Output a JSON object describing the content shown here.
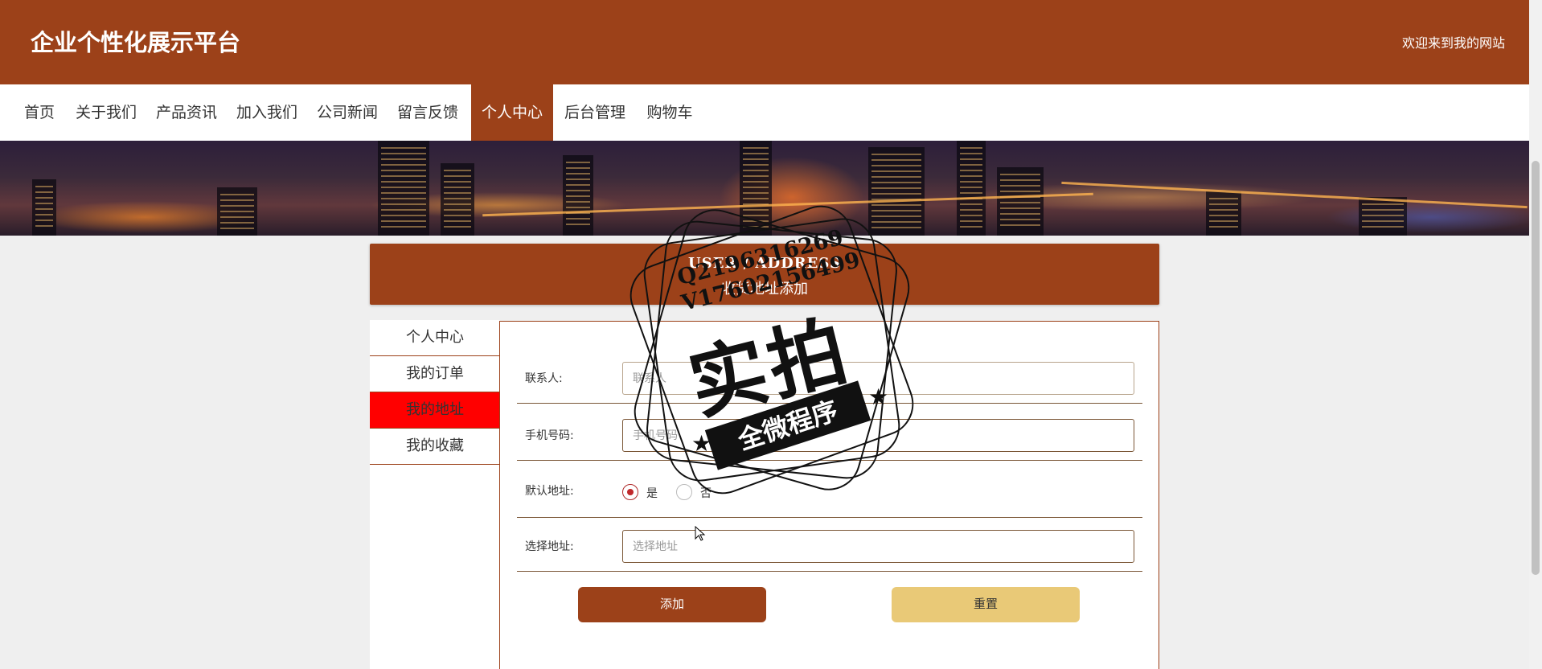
{
  "header": {
    "site_title": "企业个性化展示平台",
    "welcome": "欢迎来到我的网站"
  },
  "nav": [
    {
      "label": "首页",
      "active": false
    },
    {
      "label": "关于我们",
      "active": false
    },
    {
      "label": "产品资讯",
      "active": false
    },
    {
      "label": "加入我们",
      "active": false
    },
    {
      "label": "公司新闻",
      "active": false
    },
    {
      "label": "留言反馈",
      "active": false
    },
    {
      "label": "个人中心",
      "active": true
    },
    {
      "label": "后台管理",
      "active": false
    },
    {
      "label": "购物车",
      "active": false
    }
  ],
  "page_header": {
    "title_en": "USER / ADDRESS",
    "title_cn": "收货地址添加"
  },
  "side_menu": [
    {
      "label": "个人中心",
      "active": false
    },
    {
      "label": "我的订单",
      "active": false
    },
    {
      "label": "我的地址",
      "active": true
    },
    {
      "label": "我的收藏",
      "active": false
    }
  ],
  "form": {
    "contact": {
      "label": "联系人:",
      "placeholder": "联系人",
      "value": ""
    },
    "phone": {
      "label": "手机号码:",
      "placeholder": "手机号码",
      "value": ""
    },
    "default_address": {
      "label": "默认地址:",
      "options": [
        {
          "label": "是",
          "checked": true
        },
        {
          "label": "否",
          "checked": false
        }
      ]
    },
    "address": {
      "label": "选择地址:",
      "placeholder": "选择地址",
      "value": ""
    },
    "add_label": "添加",
    "reset_label": "重置"
  },
  "watermark": {
    "qq": "Q2196316269",
    "vx": "V17602156499",
    "main": "实拍",
    "ribbon": "全微程序"
  },
  "colors": {
    "brand": "#9c4119",
    "active_side": "#ff0000",
    "reset_button": "#e9c977"
  }
}
